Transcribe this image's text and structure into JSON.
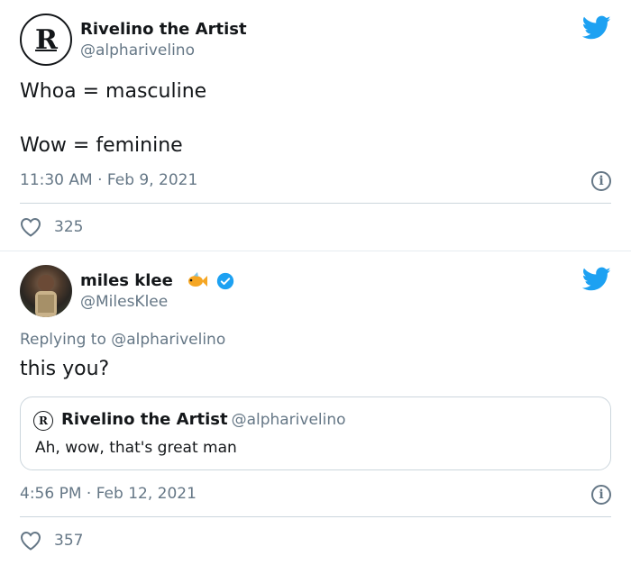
{
  "tweet1": {
    "name": "Rivelino the Artist",
    "handle": "@alpharivelino",
    "line1": "Whoa = masculine",
    "line2": "Wow = feminine",
    "timestamp": "11:30 AM · Feb 9, 2021",
    "likes": "325",
    "icons": [
      "rivelino-avatar",
      "twitter-bird-icon",
      "info-icon",
      "heart-icon"
    ]
  },
  "tweet2": {
    "name": "miles klee",
    "handle": "@MilesKlee",
    "replying_prefix": "Replying to ",
    "replying_handle": "@alpharivelino",
    "text": "this you?",
    "quote": {
      "name": "Rivelino the Artist",
      "handle": "@alpharivelino",
      "text": "Ah, wow, that's great man"
    },
    "timestamp": "4:56 PM · Feb 12, 2021",
    "likes": "357",
    "icons": [
      "fish-emoji-icon",
      "verified-badge-icon",
      "twitter-bird-icon",
      "info-icon",
      "heart-icon"
    ]
  },
  "colors": {
    "twitter_blue": "#1da1f2",
    "secondary_text": "#657786",
    "primary_text": "#14171a"
  }
}
